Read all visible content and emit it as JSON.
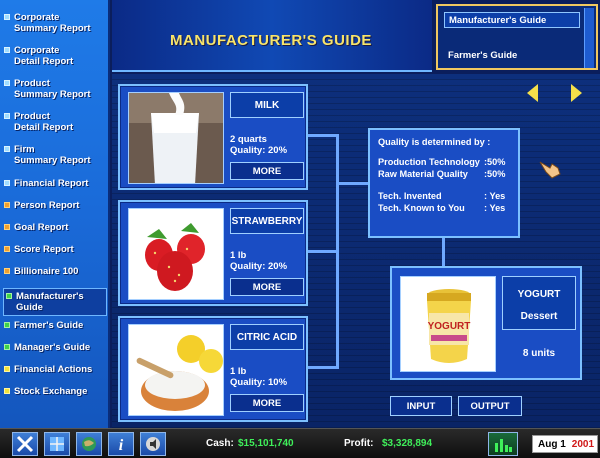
{
  "sidebar": {
    "items": [
      {
        "label": "Corporate\nSummary Report",
        "bullet": "blue"
      },
      {
        "label": "Corporate\nDetail Report",
        "bullet": "blue"
      },
      {
        "label": "Product\nSummary Report",
        "bullet": "blue"
      },
      {
        "label": "Product\nDetail Report",
        "bullet": "blue"
      },
      {
        "label": "Firm\nSummary Report",
        "bullet": "blue"
      },
      {
        "label": "Financial Report",
        "bullet": "blue"
      },
      {
        "label": "Person Report",
        "bullet": "orange"
      },
      {
        "label": "Goal Report",
        "bullet": "orange"
      },
      {
        "label": "Score Report",
        "bullet": "orange"
      },
      {
        "label": "Billionaire 100",
        "bullet": "orange"
      },
      {
        "label": "Manufacturer's\nGuide",
        "bullet": "green",
        "active": true
      },
      {
        "label": "Farmer's Guide",
        "bullet": "green"
      },
      {
        "label": "Manager's Guide",
        "bullet": "green"
      },
      {
        "label": "Financial Actions",
        "bullet": "yellow"
      },
      {
        "label": "Stock Exchange",
        "bullet": "yellow"
      }
    ]
  },
  "header": {
    "title": "MANUFACTURER'S GUIDE"
  },
  "tabs": [
    {
      "label": "Manufacturer's Guide",
      "active": true
    },
    {
      "label": "Farmer's Guide",
      "active": false
    }
  ],
  "inputs": [
    {
      "name": "MILK",
      "qty": "2 quarts",
      "quality": "Quality: 20%",
      "more": "MORE"
    },
    {
      "name": "STRAWBERRY",
      "qty": "1 lb",
      "quality": "Quality: 20%",
      "more": "MORE"
    },
    {
      "name": "CITRIC ACID",
      "qty": "1 lb",
      "quality": "Quality: 10%",
      "more": "MORE"
    }
  ],
  "quality": {
    "heading": "Quality is determined by :",
    "rows": [
      {
        "k": "Production Technology",
        "v": ":50%"
      },
      {
        "k": "Raw Material Quality",
        "v": ":50%"
      },
      {
        "k": "Tech. Invented",
        "v": ": Yes"
      },
      {
        "k": "Tech. Known to You",
        "v": ": Yes"
      }
    ]
  },
  "output": {
    "name": "YOGURT",
    "category": "Dessert",
    "units": "8 units",
    "jar_label": "YOGURT"
  },
  "buttons": {
    "input": "INPUT",
    "output": "OUTPUT"
  },
  "status": {
    "cash_label": "Cash:",
    "cash": "$15,101,740",
    "profit_label": "Profit:",
    "profit": "$3,328,894",
    "date": "Aug 1",
    "year": "2001"
  },
  "colors": {
    "title": "#f7e46b",
    "money": "#3ff05a",
    "year": "#d01818",
    "accent_border": "#7cc0ff"
  }
}
